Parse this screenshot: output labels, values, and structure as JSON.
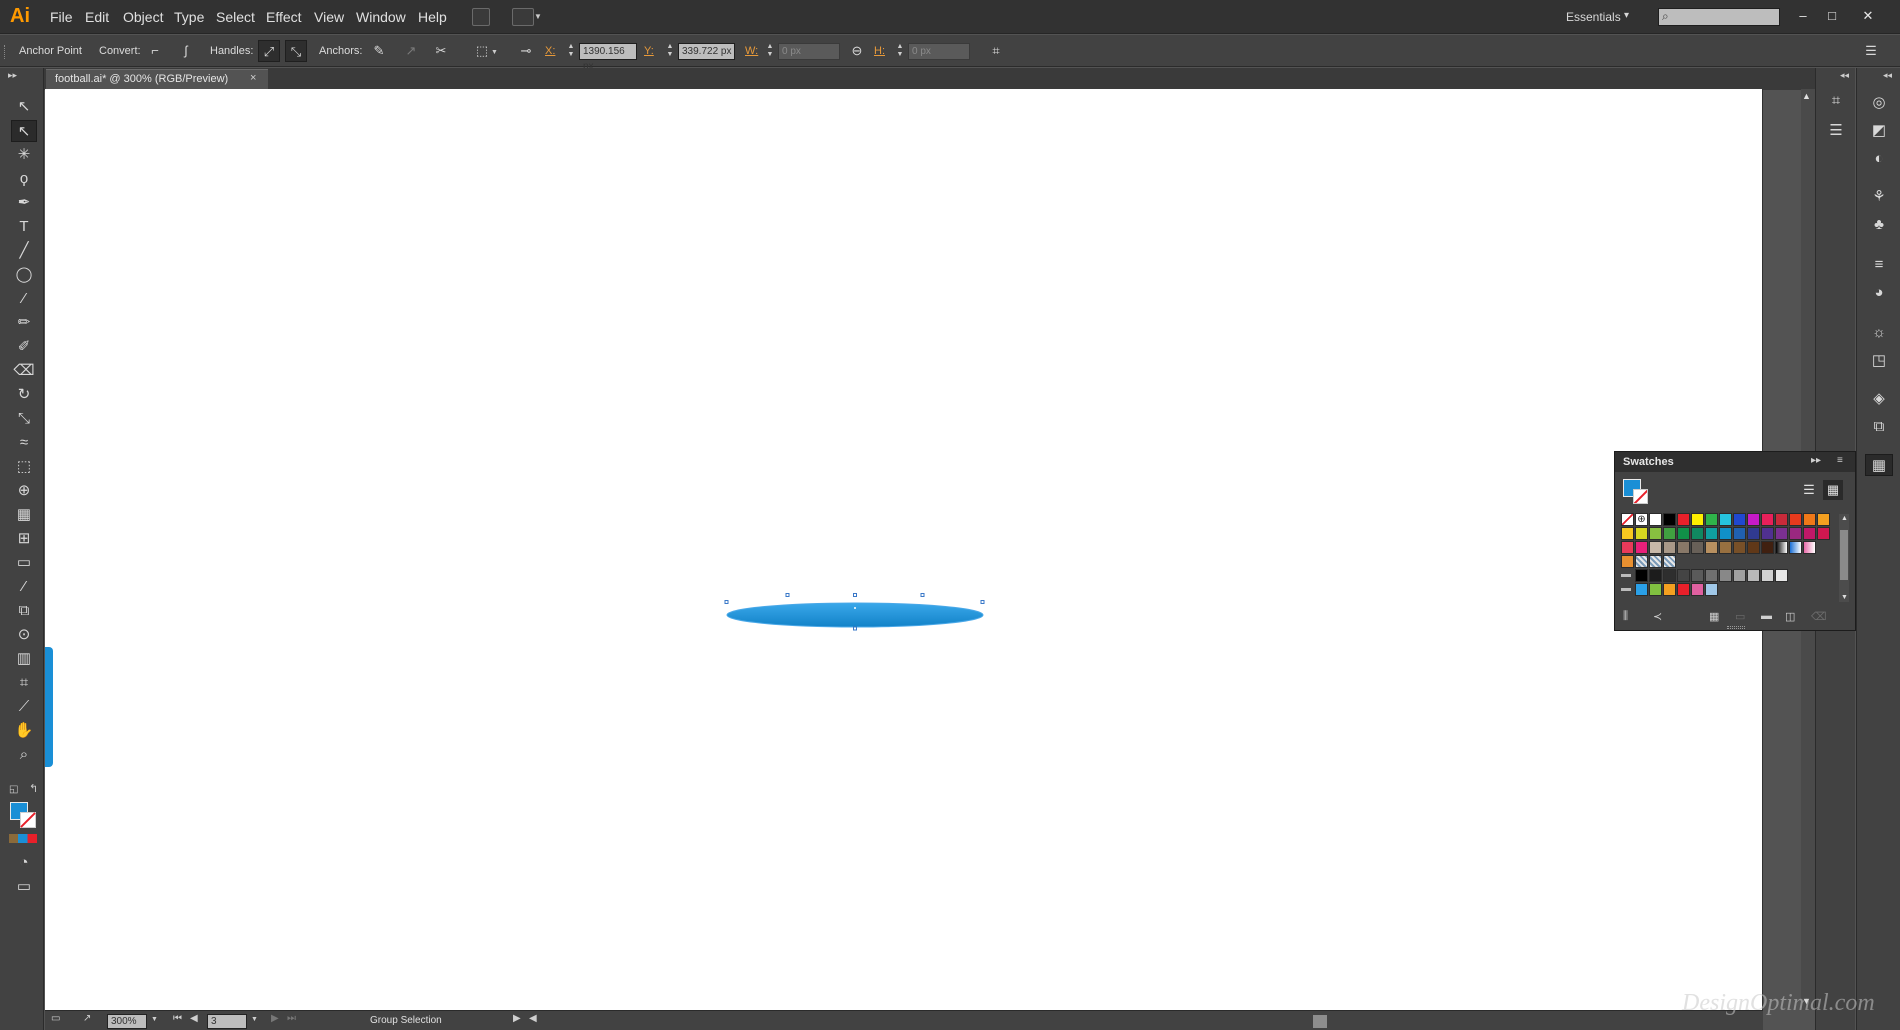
{
  "app": {
    "logo": "Ai",
    "menu": [
      "File",
      "Edit",
      "Object",
      "Type",
      "Select",
      "Effect",
      "View",
      "Window",
      "Help"
    ],
    "workspace": "Essentials",
    "search_placeholder": "",
    "window_controls": {
      "minimize": "–",
      "maximize": "□",
      "close": "✕"
    }
  },
  "control_bar": {
    "anchor_point": "Anchor Point",
    "convert": "Convert:",
    "handles": "Handles:",
    "anchors": "Anchors:",
    "x_label": "X:",
    "x_value": "1390.156 px",
    "y_label": "Y:",
    "y_value": "339.722 px",
    "w_label": "W:",
    "w_value": "0 px",
    "h_label": "H:",
    "h_value": "0 px"
  },
  "document": {
    "tab_title": "football.ai* @ 300% (RGB/Preview)",
    "tab_close": "×"
  },
  "status_bar": {
    "zoom": "300%",
    "artboard": "3",
    "status": "Group Selection"
  },
  "swatches": {
    "title": "Swatches",
    "fill_color": "#1a8fd6",
    "rows": [
      [
        "none",
        "reg",
        "#ffffff",
        "#000000",
        "#e8202a",
        "#ffee00",
        "#2fb34a",
        "#26c4df",
        "#2048d0",
        "#c61ac8",
        "#e8205a",
        "#c82a3a",
        "#e83a1c",
        "#f07818",
        "#f4a020"
      ],
      [
        "#f8c820",
        "#d8d820",
        "#88c040",
        "#40a040",
        "#109048",
        "#108860",
        "#10a0a0",
        "#1090c8",
        "#2060b0",
        "#303a90",
        "#503090",
        "#7a3090",
        "#9a2880",
        "#c01868",
        "#d01850"
      ],
      [
        "#e83a5a",
        "#e8207a",
        "#c8b8a8",
        "#a89888",
        "#887868",
        "#686058",
        "#b89060",
        "#987040",
        "#785028",
        "#603818",
        "#402010",
        "grad-gray",
        "grad-blue",
        "grad-pink"
      ],
      [
        "#e89030",
        "pattern-1",
        "pattern-2",
        "pattern-3"
      ],
      [
        "folder",
        "#000000",
        "#1c1c1c",
        "#2e2e2e",
        "#444444",
        "#5a5a5a",
        "#707070",
        "#888888",
        "#a0a0a0",
        "#b8b8b8",
        "#d0d0d0",
        "#e8e8e8"
      ],
      [
        "folder",
        "#2aa0e8",
        "#80c040",
        "#f4a020",
        "#e8202a",
        "#e060a0",
        "#a0c8e8"
      ]
    ]
  },
  "watermark": "DesignOptimal.com"
}
